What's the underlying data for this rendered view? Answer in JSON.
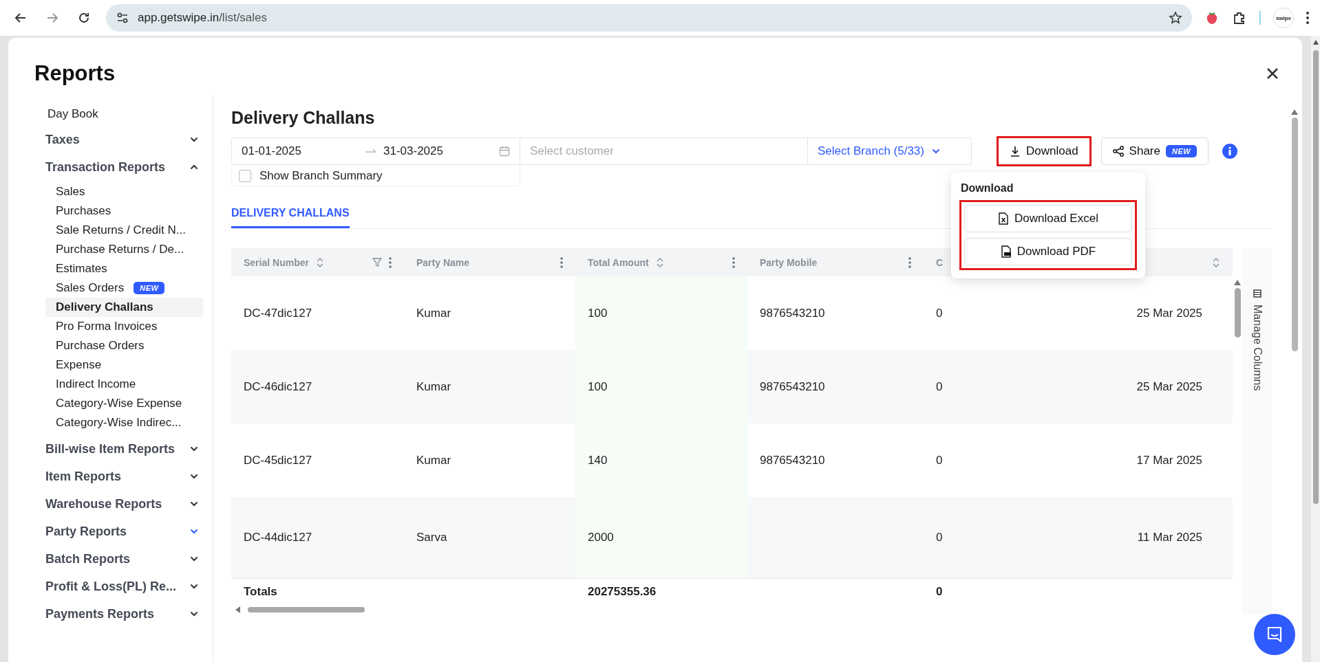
{
  "browser": {
    "url_host": "app.getswipe.in",
    "url_path": "/list/sales",
    "profile_label": "swipe"
  },
  "modal": {
    "title": "Reports"
  },
  "sidebar": {
    "items": [
      {
        "kind": "link",
        "label": "Day Book"
      },
      {
        "kind": "group",
        "label": "Taxes",
        "expanded": false,
        "hovered": false
      },
      {
        "kind": "group",
        "label": "Transaction Reports",
        "expanded": true,
        "hovered": false,
        "children": [
          {
            "label": "Sales",
            "selected": false
          },
          {
            "label": "Purchases",
            "selected": false
          },
          {
            "label": "Sale Returns / Credit N...",
            "selected": false
          },
          {
            "label": "Purchase Returns / De...",
            "selected": false
          },
          {
            "label": "Estimates",
            "selected": false
          },
          {
            "label": "Sales Orders",
            "selected": false,
            "badge": "NEW"
          },
          {
            "label": "Delivery Challans",
            "selected": true
          },
          {
            "label": "Pro Forma Invoices",
            "selected": false
          },
          {
            "label": "Purchase Orders",
            "selected": false
          },
          {
            "label": "Expense",
            "selected": false
          },
          {
            "label": "Indirect Income",
            "selected": false
          },
          {
            "label": "Category-Wise Expense",
            "selected": false
          },
          {
            "label": "Category-Wise Indirec...",
            "selected": false
          }
        ]
      },
      {
        "kind": "group",
        "label": "Bill-wise Item Reports",
        "expanded": false,
        "hovered": false
      },
      {
        "kind": "group",
        "label": "Item Reports",
        "expanded": false,
        "hovered": false
      },
      {
        "kind": "group",
        "label": "Warehouse Reports",
        "expanded": false,
        "hovered": false
      },
      {
        "kind": "group",
        "label": "Party Reports",
        "expanded": false,
        "hovered": true
      },
      {
        "kind": "group",
        "label": "Batch Reports",
        "expanded": false,
        "hovered": false
      },
      {
        "kind": "group",
        "label": "Profit & Loss(PL) Re...",
        "expanded": false,
        "hovered": false
      },
      {
        "kind": "group",
        "label": "Payments Reports",
        "expanded": false,
        "hovered": false
      }
    ]
  },
  "report": {
    "title": "Delivery Challans",
    "date_range": {
      "start": "01-01-2025",
      "end": "31-03-2025"
    },
    "customer_field": {
      "placeholder": "Select customer"
    },
    "branch_select": {
      "label": "Select Branch (5/33)"
    },
    "download_button": {
      "label": "Download",
      "highlighted": true
    },
    "share_button": {
      "label": "Share",
      "badge": "NEW"
    },
    "branch_summary": {
      "label": "Show Branch Summary",
      "checked": false
    },
    "download_menu": {
      "title": "Download",
      "highlighted": true,
      "options": [
        {
          "kind": "excel",
          "label": "Download Excel"
        },
        {
          "kind": "pdf",
          "label": "Download PDF"
        }
      ]
    },
    "tabs": [
      {
        "label": "DELIVERY CHALLANS",
        "selected": true
      }
    ],
    "table": {
      "columns": [
        {
          "label": "Serial Number",
          "sortable": true,
          "filterable": true,
          "menu": true
        },
        {
          "label": "Party Name",
          "sortable": false,
          "filterable": false,
          "menu": true
        },
        {
          "label": "Total Amount",
          "sortable": true,
          "filterable": false,
          "menu": true
        },
        {
          "label": "Party Mobile",
          "sortable": false,
          "filterable": false,
          "menu": true
        },
        {
          "label": "C"
        },
        {
          "sortable": true,
          "filterable": false,
          "menu": false
        }
      ],
      "rows": [
        [
          "DC-47dic127",
          "Kumar",
          "100",
          "9876543210",
          "0",
          "25 Mar 2025"
        ],
        [
          "DC-46dic127",
          "Kumar",
          "100",
          "9876543210",
          "0",
          "25 Mar 2025"
        ],
        [
          "DC-45dic127",
          "Kumar",
          "140",
          "9876543210",
          "0",
          "17 Mar 2025"
        ],
        [
          "DC-44dic127",
          "Sarva",
          "2000",
          null,
          "0",
          "11 Mar 2025"
        ]
      ],
      "totals": {
        "label": "Totals",
        "total_amount": "20275355.36",
        "column_5": "0"
      }
    },
    "manage_columns": {
      "label": "Manage Columns"
    }
  }
}
